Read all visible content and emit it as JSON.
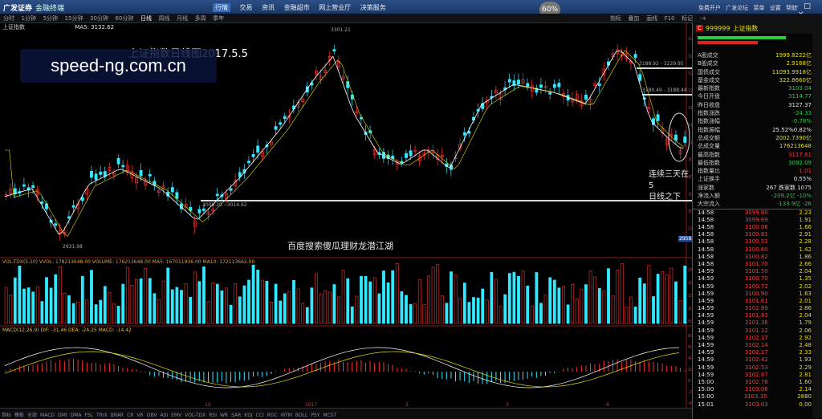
{
  "titlebar": {
    "logo": "广发证券",
    "app_name": "金融终端",
    "menus": [
      "行情",
      "交易",
      "资讯",
      "金融超市",
      "网上营业厅",
      "决策服务"
    ],
    "zoom": "60",
    "right_links": [
      "免费开户",
      "广发论坛",
      "菜单",
      "设置",
      "帮助"
    ]
  },
  "toolbar": {
    "periods": [
      "分时",
      "1分钟",
      "5分钟",
      "15分钟",
      "30分钟",
      "60分钟",
      "日线",
      "周线",
      "月线",
      "多周",
      "季年"
    ],
    "right_tools": [
      "指标",
      "叠加",
      "画线",
      "F10",
      "标记",
      "-+"
    ]
  },
  "chart": {
    "header_title": "上证指数",
    "ma_label": "MA5: 3132.62",
    "overlay_title": "上证指数日线图2017.5.5",
    "watermark": "speed-ng.com.cn",
    "price_labels": {
      "high": "3301.21",
      "low": "2931.98",
      "low2": "2958.6",
      "band1": "3009.20 - 3014.62",
      "band2": "3188.92 - 3229.95",
      "band3": "3180.49 - 3188.44"
    },
    "annotation": [
      "连续三天在5",
      "日线之下"
    ],
    "center_text": "百度搜索傻瓜理财龙潜江湖",
    "volume_label": "VOL-TDX(5,10) VVOL: 178213648.00  VOLUME: 176213648.00  MA5: 167011936.00  MA10: 172113662.00",
    "macd_label": "MACD(12,26,9) DIF: -31.46  DEA: -24.25  MACD: -14.42",
    "y_axis": [
      "3251",
      "3225",
      "3200",
      "3175",
      "3150",
      "3125",
      "3100",
      "3075",
      "3050",
      "3025",
      "3000",
      "2975"
    ],
    "vol_axis": [
      "2500",
      "20000",
      "15000",
      "10000",
      "5000"
    ],
    "macd_axis": [
      "80.00",
      "60.00",
      "40.00",
      "20.00",
      "0.00",
      "-20.00",
      "-40.00"
    ],
    "x_axis": [
      "12",
      "2017",
      "2",
      "3",
      "4",
      "5"
    ]
  },
  "bottom_bar": [
    "指标",
    "模板",
    "全部",
    "MACD",
    "DMI",
    "DMA",
    "FSL",
    "TRIX",
    "BRAR",
    "CR",
    "VR",
    "OBV",
    "ASI",
    "EMV",
    "VOL-TDX",
    "RSI",
    "WR",
    "SAR",
    "KDJ",
    "CCI",
    "ROC",
    "MTM",
    "BOLL",
    "PSY",
    "MCST"
  ],
  "quote": {
    "code": "999999",
    "name": "上证指数",
    "rows": [
      {
        "label": "A股成交",
        "value": "1999.8222亿",
        "cls": "yellow"
      },
      {
        "label": "B股成交",
        "value": "2.9168亿",
        "cls": "yellow"
      },
      {
        "label": "国债成交",
        "value": "11093.9918亿",
        "cls": "yellow"
      },
      {
        "label": "基金成交",
        "value": "322.8660亿",
        "cls": "yellow"
      },
      {
        "label": "最新指数",
        "value": "3103.04",
        "cls": "green"
      },
      {
        "label": "今日开盘",
        "value": "3114.77",
        "cls": "green"
      },
      {
        "label": "昨日收盘",
        "value": "3127.37",
        "cls": "white"
      },
      {
        "label": "指数涨跌",
        "value": "-24.33",
        "cls": "green"
      },
      {
        "label": "指数涨幅",
        "value": "-0.78%",
        "cls": "green"
      },
      {
        "label": "指数振幅",
        "value": "25.52%0.82%",
        "cls": "white"
      },
      {
        "label": "总成交额",
        "value": "2002.7390亿",
        "cls": "yellow"
      },
      {
        "label": "总成交量",
        "value": "176213648",
        "cls": "yellow"
      },
      {
        "label": "最高指数",
        "value": "3117.61",
        "cls": "red"
      },
      {
        "label": "最低指数",
        "value": "3092.09",
        "cls": "green"
      },
      {
        "label": "指数量比",
        "value": "1.01",
        "cls": "red"
      },
      {
        "label": "上证换手",
        "value": "0.55%",
        "cls": "white"
      },
      {
        "label": "涨家数",
        "value": "267  跌家数  1075",
        "cls": "white"
      },
      {
        "label": "净流入额",
        "value": "-209.2亿  -10%",
        "cls": "green"
      },
      {
        "label": "大宗流入",
        "value": "-133.9亿  -26",
        "cls": "green"
      }
    ],
    "ticks": [
      [
        "14:58",
        "3099.90",
        "2.23"
      ],
      [
        "14:58",
        "3099.69",
        "1.91"
      ],
      [
        "14:58",
        "3100.06",
        "1.66"
      ],
      [
        "14:58",
        "3100.81",
        "2.91"
      ],
      [
        "14:58",
        "3100.51",
        "2.28"
      ],
      [
        "14:58",
        "3100.60",
        "1.42"
      ],
      [
        "14:58",
        "3100.82",
        "1.86"
      ],
      [
        "14:58",
        "3101.70",
        "2.66"
      ],
      [
        "14:59",
        "3101.50",
        "2.04"
      ],
      [
        "14:59",
        "3100.70",
        "1.35"
      ],
      [
        "14:59",
        "3100.72",
        "2.02"
      ],
      [
        "14:59",
        "3100.90",
        "1.63"
      ],
      [
        "14:59",
        "3101.61",
        "2.01"
      ],
      [
        "14:59",
        "3102.89",
        "2.86"
      ],
      [
        "14:59",
        "3101.83",
        "2.04"
      ],
      [
        "14:59",
        "3101.36",
        "1.79"
      ],
      [
        "14:59",
        "3101.12",
        "2.06"
      ],
      [
        "14:59",
        "3102.17",
        "2.92"
      ],
      [
        "14:59",
        "3102.14",
        "2.48"
      ],
      [
        "14:59",
        "3102.17",
        "2.33"
      ],
      [
        "14:59",
        "3102.42",
        "1.93"
      ],
      [
        "14:59",
        "3102.53",
        "2.29"
      ],
      [
        "14:59",
        "3102.87",
        "2.81"
      ],
      [
        "15:00",
        "3102.78",
        "1.60"
      ],
      [
        "15:00",
        "3103.06",
        "2.14"
      ],
      [
        "15:00",
        "3103.35",
        "2880"
      ],
      [
        "15:01",
        "3103.03",
        "0.00"
      ]
    ]
  }
}
